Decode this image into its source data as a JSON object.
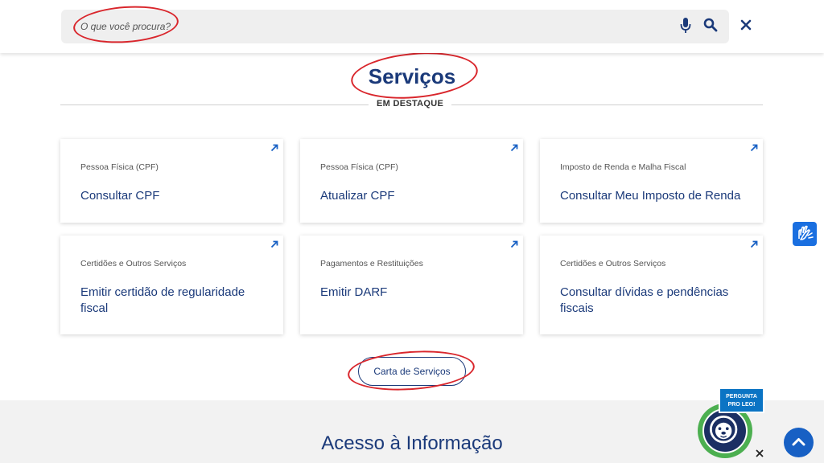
{
  "search": {
    "placeholder": "O que você procura?"
  },
  "section": {
    "title": "Serviços",
    "featured_label": "EM DESTAQUE"
  },
  "cards": [
    {
      "category": "Pessoa Física (CPF)",
      "title": "Consultar CPF"
    },
    {
      "category": "Pessoa Física (CPF)",
      "title": "Atualizar CPF"
    },
    {
      "category": "Imposto de Renda e Malha Fiscal",
      "title": "Consultar Meu Imposto de Renda"
    },
    {
      "category": "Certidões e Outros Serviços",
      "title": "Emitir certidão de regularidade fiscal"
    },
    {
      "category": "Pagamentos e Restituições",
      "title": "Emitir DARF"
    },
    {
      "category": "Certidões e Outros Serviços",
      "title": "Consultar dívidas e pendências fiscais"
    }
  ],
  "carta_button": "Carta de Serviços",
  "info_section": {
    "title": "Acesso à Informação"
  },
  "leo_badge": {
    "line1": "PERGUNTA",
    "line2": "PRO LEO!"
  },
  "icons": {
    "mic": "mic-icon",
    "search": "search-icon",
    "close": "close-icon",
    "arrow": "external-arrow-icon",
    "vlibras": "sign-language-icon",
    "scroll_top": "chevron-up-icon",
    "leo": "lion-mascot-icon"
  },
  "colors": {
    "brand": "#1b3a7a",
    "accent": "#1760c4",
    "highlight": "#d9262c",
    "leo_ring": "#4caf50"
  }
}
